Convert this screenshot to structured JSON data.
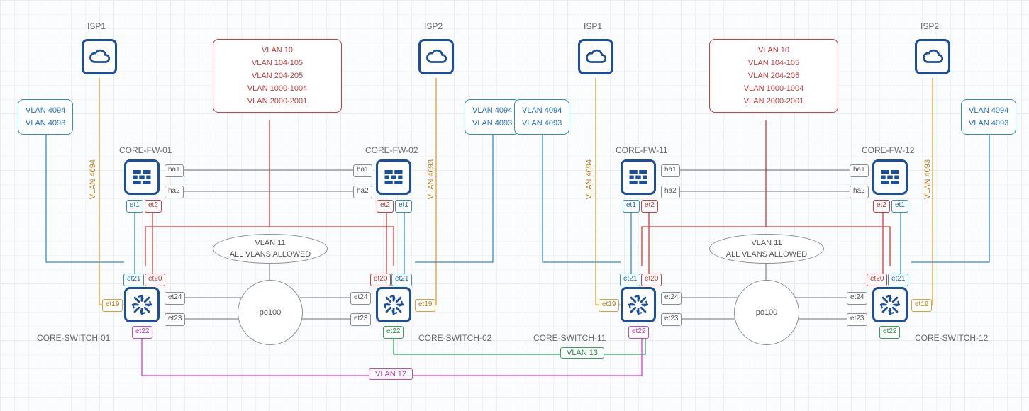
{
  "isp1": "ISP1",
  "isp2": "ISP2",
  "fw": {
    "left": "CORE-FW-01",
    "right": "CORE-FW-02",
    "left2": "CORE-FW-11",
    "right2": "CORE-FW-12"
  },
  "sw": {
    "left": "CORE-SWITCH-01",
    "right": "CORE-SWITCH-02",
    "left2": "CORE-SWITCH-11",
    "right2": "CORE-SWITCH-12"
  },
  "red_vlans": {
    "l1": "VLAN 10",
    "l2": "VLAN 104-105",
    "l3": "VLAN 204-205",
    "l4": "VLAN 1000-1004",
    "l5": "VLAN 2000-2001"
  },
  "peer": {
    "l1": "VLAN 4094",
    "l2": "VLAN 4093"
  },
  "trunk": {
    "l1": "VLAN 11",
    "l2": "ALL VLANS ALLOWED"
  },
  "po": "po100",
  "ports": {
    "ha1": "ha1",
    "ha2": "ha2",
    "et1": "et1",
    "et2": "et2",
    "et19": "et19",
    "et20": "et20",
    "et21": "et21",
    "et22": "et22",
    "et23": "et23",
    "et24": "et24"
  },
  "vlabel": {
    "l": "VLAN 4094",
    "r": "VLAN 4093"
  },
  "link": {
    "v12": "VLAN 12",
    "v13": "VLAN 13"
  }
}
